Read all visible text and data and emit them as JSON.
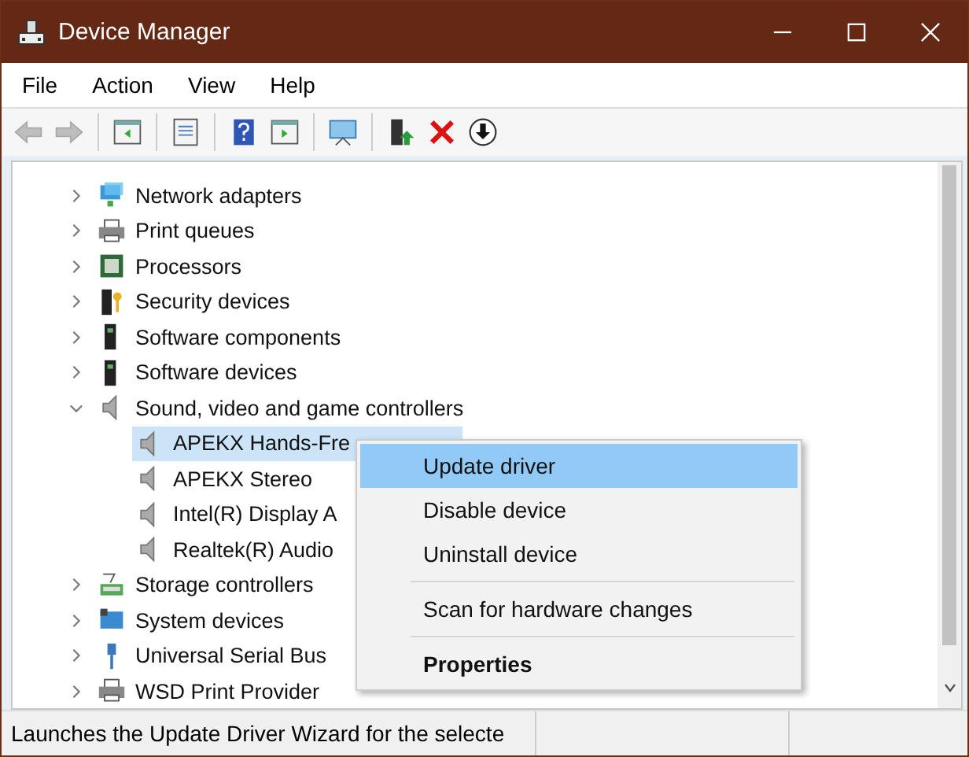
{
  "window": {
    "title": "Device Manager"
  },
  "menu": [
    {
      "label": "File"
    },
    {
      "label": "Action"
    },
    {
      "label": "View"
    },
    {
      "label": "Help"
    }
  ],
  "toolbar": [
    {
      "kind": "back",
      "disabled": true
    },
    {
      "kind": "forward",
      "disabled": true
    },
    {
      "kind": "sep"
    },
    {
      "kind": "panel",
      "disabled": false
    },
    {
      "kind": "sep"
    },
    {
      "kind": "props",
      "disabled": false
    },
    {
      "kind": "sep"
    },
    {
      "kind": "help",
      "disabled": false
    },
    {
      "kind": "play",
      "disabled": false
    },
    {
      "kind": "sep"
    },
    {
      "kind": "monitor",
      "disabled": false
    },
    {
      "kind": "sep"
    },
    {
      "kind": "update",
      "disabled": false
    },
    {
      "kind": "uninstall",
      "disabled": false
    },
    {
      "kind": "download",
      "disabled": false
    }
  ],
  "tree": [
    {
      "label": "Network adapters",
      "kind": "network",
      "expanded": false
    },
    {
      "label": "Print queues",
      "kind": "printer",
      "expanded": false
    },
    {
      "label": "Processors",
      "kind": "chip",
      "expanded": false
    },
    {
      "label": "Security devices",
      "kind": "key",
      "expanded": false
    },
    {
      "label": "Software components",
      "kind": "tower",
      "expanded": false
    },
    {
      "label": "Software devices",
      "kind": "tower",
      "expanded": false
    },
    {
      "label": "Sound, video and game controllers",
      "kind": "speaker",
      "expanded": true,
      "children": [
        {
          "label": "APEKX Hands-Fre",
          "selected": true
        },
        {
          "label": "APEKX Stereo",
          "selected": false
        },
        {
          "label": "Intel(R) Display A",
          "selected": false
        },
        {
          "label": "Realtek(R) Audio",
          "selected": false
        }
      ]
    },
    {
      "label": "Storage controllers",
      "kind": "storage",
      "expanded": false
    },
    {
      "label": "System devices",
      "kind": "system",
      "expanded": false
    },
    {
      "label": "Universal Serial Bus",
      "kind": "usb",
      "expanded": false
    },
    {
      "label": "WSD Print Provider",
      "kind": "printer",
      "expanded": false
    }
  ],
  "context_menu": [
    {
      "kind": "item",
      "label": "Update driver",
      "selected": true,
      "bold": false
    },
    {
      "kind": "item",
      "label": "Disable device",
      "selected": false,
      "bold": false
    },
    {
      "kind": "item",
      "label": "Uninstall device",
      "selected": false,
      "bold": false
    },
    {
      "kind": "separator"
    },
    {
      "kind": "item",
      "label": "Scan for hardware changes",
      "selected": false,
      "bold": false
    },
    {
      "kind": "separator"
    },
    {
      "kind": "item",
      "label": "Properties",
      "selected": false,
      "bold": true
    }
  ],
  "status_bar": "Launches the Update Driver Wizard for the selecte"
}
